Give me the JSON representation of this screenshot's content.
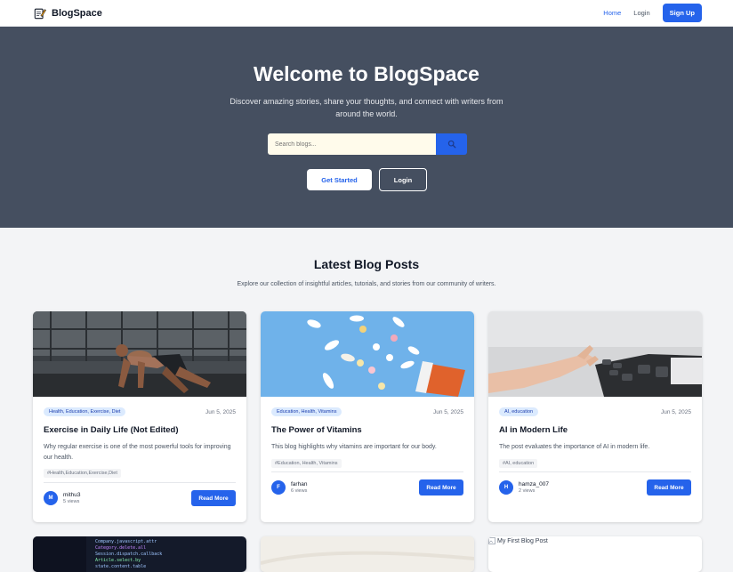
{
  "nav": {
    "brand": "BlogSpace",
    "home": "Home",
    "login": "Login",
    "signup": "Sign Up"
  },
  "hero": {
    "title": "Welcome to BlogSpace",
    "subtitle": "Discover amazing stories, share your thoughts, and connect with writers from around the world.",
    "search_placeholder": "Search blogs...",
    "get_started": "Get Started",
    "login": "Login"
  },
  "section": {
    "title": "Latest Blog Posts",
    "subtitle": "Explore our collection of insightful articles, tutorials, and stories from our community of writers."
  },
  "cards": [
    {
      "category": "Health, Education, Exercise, Diet",
      "date": "Jun 5, 2025",
      "title": "Exercise in Daily Life (Not Edited)",
      "excerpt": "Why regular exercise is one of the most powerful tools for improving our health.",
      "tags": "#Health,Education,Exercise,Diet",
      "avatar": "M",
      "author": "mithu3",
      "views": "5 views",
      "read_more": "Read More"
    },
    {
      "category": "Education, Health, Vitamins",
      "date": "Jun 5, 2025",
      "title": "The Power of Vitamins",
      "excerpt": "This blog highlights why vitamins are important for our body.",
      "tags": "#Education, Health, Vitamins",
      "avatar": "F",
      "author": "farhan",
      "views": "6 views",
      "read_more": "Read More"
    },
    {
      "category": "AI, education",
      "date": "Jun 5, 2025",
      "title": "AI in Modern Life",
      "excerpt": "The post evaluates the importance of AI in modern life.",
      "tags": "#AI, education",
      "avatar": "H",
      "author": "hamza_007",
      "views": "2 views",
      "read_more": "Read More"
    }
  ],
  "second_row": {
    "broken_image_alt": "My First Blog Post"
  },
  "colors": {
    "accent": "#2563eb",
    "hero_bg": "#454f60",
    "page_bg": "#f3f4f6"
  }
}
